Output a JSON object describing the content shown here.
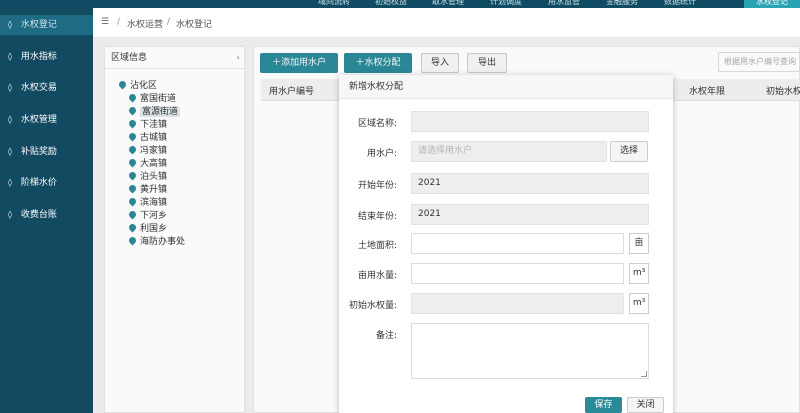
{
  "topbar": {
    "items": [
      "域间流转",
      "初始权益",
      "取水管理",
      "计划调度",
      "用水监管",
      "金融服务",
      "数据统计"
    ],
    "active_item": "水权登记"
  },
  "sidebar": {
    "items": [
      {
        "label": "水权登记",
        "icon": "drop-icon"
      },
      {
        "label": "用水指标",
        "icon": "drop-icon"
      },
      {
        "label": "水权交易",
        "icon": "drop-icon"
      },
      {
        "label": "水权管理",
        "icon": "drop-icon"
      },
      {
        "label": "补贴奖励",
        "icon": "drop-icon"
      },
      {
        "label": "阶梯水价",
        "icon": "drop-icon"
      },
      {
        "label": "收费台账",
        "icon": "drop-icon"
      }
    ]
  },
  "breadcrumb": {
    "menu_icon": "☰",
    "sep": "/",
    "items": [
      "水权运营",
      "水权登记"
    ]
  },
  "tree": {
    "title": "区域信息",
    "collapse_glyph": "‹",
    "root": "沾化区",
    "children": [
      "富国街道",
      "富源街道",
      "下洼镇",
      "古城镇",
      "冯家镇",
      "大高镇",
      "泊头镇",
      "黄升镇",
      "滨海镇",
      "下河乡",
      "利国乡",
      "海防办事处"
    ]
  },
  "toolbar": {
    "add_label": "添加用水户",
    "allocate_label": "水权分配",
    "import_label": "导入",
    "export_label": "导出",
    "search_placeholder": "根据用水户编号查询"
  },
  "table": {
    "headers": [
      "用水户编号",
      "水权年限",
      "初始水权"
    ]
  },
  "modal": {
    "title": "新增水权分配",
    "fields": {
      "region_label": "区域名称:",
      "region_value": "",
      "user_label": "用水户:",
      "user_placeholder": "请选择用水户",
      "select_label": "选择",
      "start_label": "开始年份:",
      "start_value": "2021",
      "end_label": "结束年份:",
      "end_value": "2021",
      "land_label": "土地面积:",
      "land_unit": "亩",
      "per_mu_label": "亩用水量:",
      "per_mu_unit": "m³",
      "initial_label": "初始水权量:",
      "initial_unit": "m³",
      "note_label": "备注:"
    },
    "save_label": "保存",
    "close_label": "关闭"
  },
  "colors": {
    "sidebar_bg": "#124a62",
    "accent": "#2b8a98",
    "topbar_bg": "#0f4b63"
  }
}
